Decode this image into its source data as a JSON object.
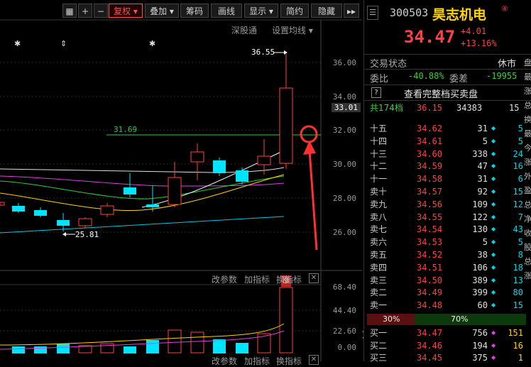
{
  "toolbar": {
    "buttons": [
      "复权",
      "叠加",
      "筹码",
      "画线",
      "显示",
      "简约",
      "隐藏"
    ],
    "sub_links": [
      "深股通",
      "设置均线"
    ]
  },
  "chart": {
    "price_labels": [
      "36.00",
      "34.00",
      "33.01",
      "32.00",
      "30.00",
      "28.00",
      "26.00"
    ],
    "high_marker": "36.55",
    "low_marker": "25.81",
    "line_label": "31.69",
    "limit_up_badge": "涨",
    "markers": [
      "✱",
      "⇕",
      "✱"
    ],
    "lower_links": [
      "改参数",
      "加指标",
      "换指标"
    ],
    "lower_links_bottom": [
      "改参数",
      "加指标",
      "换指标"
    ],
    "volume_labels": [
      "68.40",
      "44.40",
      "22.60",
      "0.00"
    ]
  },
  "stock": {
    "code": "300503",
    "name": "昊志机电",
    "badge": "④",
    "price": "34.47",
    "change": "+4.01",
    "change_pct": "+13.16%",
    "status_label": "交易状态",
    "status_value": "休市",
    "weibi_label": "委比",
    "weibi_value": "-40.88%",
    "weicha_label": "委差",
    "weicha_value": "-19955",
    "help_mark": "?",
    "full_book_link": "查看完整档买卖盘",
    "total_label": "共174档",
    "total_price": "36.15",
    "total_volume": "34383",
    "total_count": "15"
  },
  "sell_orders": [
    {
      "label": "十五",
      "price": "34.62",
      "vol": "31",
      "count": "5"
    },
    {
      "label": "十四",
      "price": "34.61",
      "vol": "5",
      "count": "5"
    },
    {
      "label": "十三",
      "price": "34.60",
      "vol": "338",
      "count": "24"
    },
    {
      "label": "十二",
      "price": "34.59",
      "vol": "47",
      "count": "16"
    },
    {
      "label": "十一",
      "price": "34.58",
      "vol": "31",
      "count": "6"
    },
    {
      "label": "卖十",
      "price": "34.57",
      "vol": "92",
      "count": "15"
    },
    {
      "label": "卖九",
      "price": "34.56",
      "vol": "109",
      "count": "12"
    },
    {
      "label": "卖八",
      "price": "34.55",
      "vol": "122",
      "count": "7"
    },
    {
      "label": "卖七",
      "price": "34.54",
      "vol": "130",
      "count": "43"
    },
    {
      "label": "卖六",
      "price": "34.53",
      "vol": "5",
      "count": "5"
    },
    {
      "label": "卖五",
      "price": "34.52",
      "vol": "38",
      "count": "8"
    },
    {
      "label": "卖四",
      "price": "34.51",
      "vol": "106",
      "count": "18"
    },
    {
      "label": "卖三",
      "price": "34.50",
      "vol": "389",
      "count": "13"
    },
    {
      "label": "卖二",
      "price": "34.49",
      "vol": "399",
      "count": "80"
    },
    {
      "label": "卖一",
      "price": "34.48",
      "vol": "60",
      "count": "15"
    }
  ],
  "ratio": {
    "buy": "30%",
    "sell": "70%",
    "buy_fraction": 0.3
  },
  "buy_orders": [
    {
      "label": "买一",
      "price": "34.47",
      "vol": "756",
      "count": "151"
    },
    {
      "label": "买二",
      "price": "34.46",
      "vol": "194",
      "count": "16"
    },
    {
      "label": "买三",
      "price": "34.45",
      "vol": "375",
      "count": "1"
    }
  ],
  "right_tabs": [
    "盘",
    "最",
    "涨",
    "总",
    "换",
    "最",
    "今",
    "涨",
    "外",
    "盈",
    "总",
    "净",
    "收",
    "股",
    "总",
    "涨"
  ],
  "colors": {
    "up": "#ff4040",
    "down": "#00e5ff",
    "accent": "#ff5050"
  }
}
